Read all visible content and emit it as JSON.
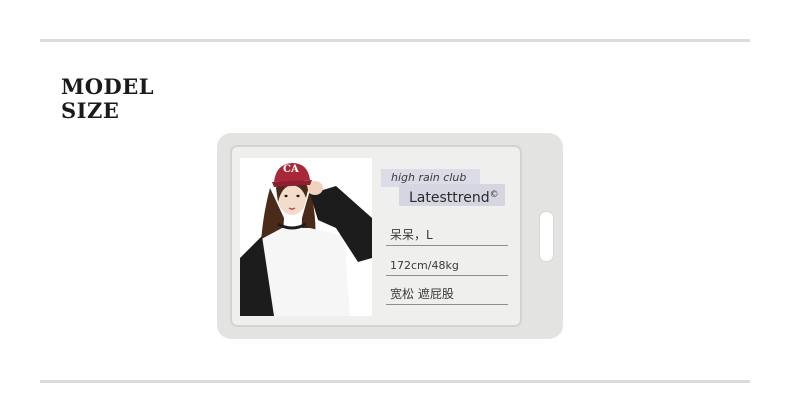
{
  "section": {
    "title_line1": "MODEL",
    "title_line2": "SIZE"
  },
  "card": {
    "brand_small": "high rain club",
    "brand_large": "Latesttrend",
    "brand_mark": "©",
    "photo": {
      "hat_text": "CA"
    },
    "fields": [
      {
        "value": "呆呆，L"
      },
      {
        "value": "172cm/48kg"
      },
      {
        "value": "宽松 遮屁股"
      }
    ]
  },
  "colors": {
    "hat": "#a8283a",
    "sleeve": "#1c1c1c",
    "hair": "#4a2a18",
    "card_bg": "#e3e3e1",
    "tag_bg": "#dcdce8"
  }
}
